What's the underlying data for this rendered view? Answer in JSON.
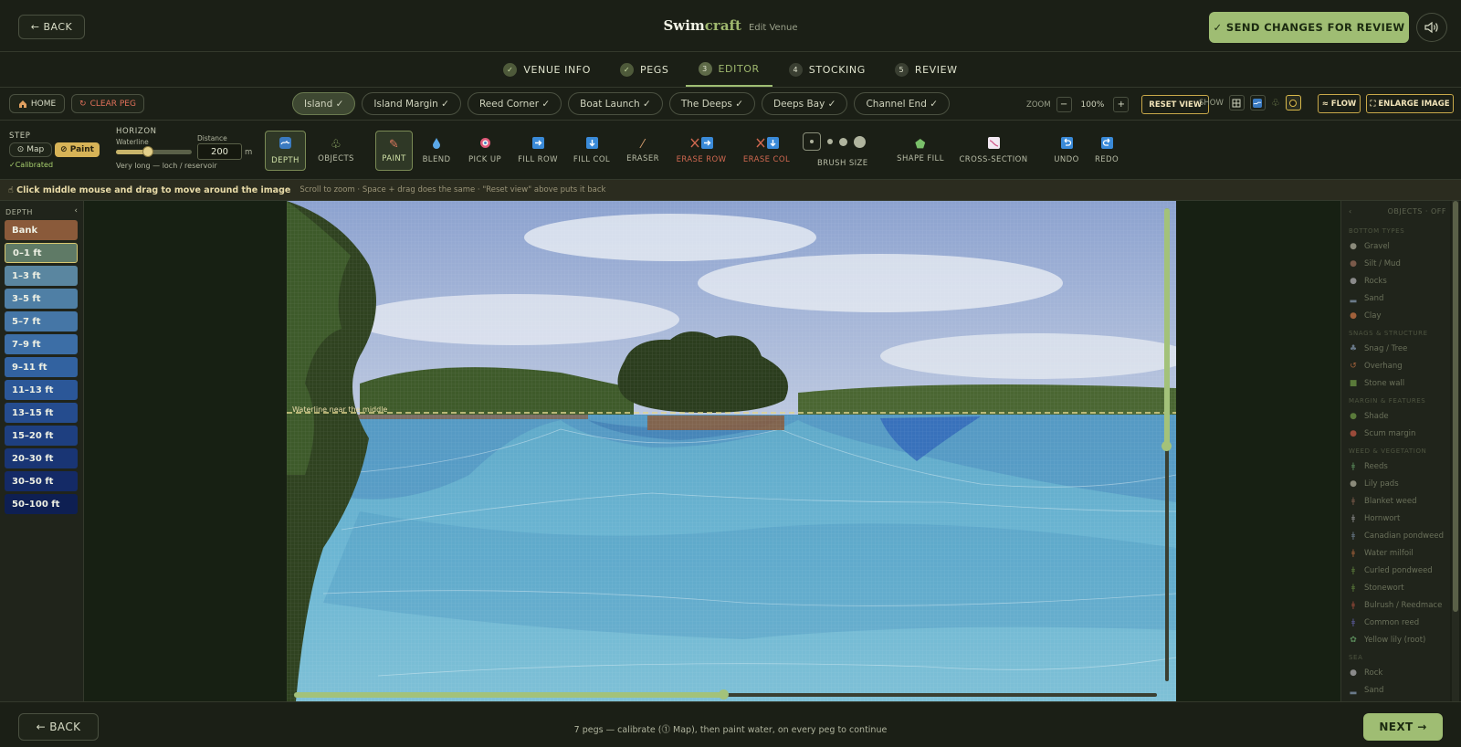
{
  "header": {
    "back_label": "← BACK",
    "brand_main": "Swim",
    "brand_accent": "craft",
    "subtitle": "Edit Venue",
    "send_label": "✓ SEND CHANGES FOR REVIEW",
    "speaker_icon": "speaker-icon"
  },
  "steps": [
    {
      "label": "VENUE INFO",
      "marker": "✓"
    },
    {
      "label": "PEGS",
      "marker": "✓"
    },
    {
      "label": "EDITOR",
      "marker": "3"
    },
    {
      "label": "STOCKING",
      "marker": "4"
    },
    {
      "label": "REVIEW",
      "marker": "5"
    }
  ],
  "pegbar": {
    "home_label": "HOME",
    "clear_label": "CLEAR PEG",
    "pegs": [
      "Island ✓",
      "Island Margin ✓",
      "Reed Corner ✓",
      "Boat Launch ✓",
      "The Deeps ✓",
      "Deeps Bay ✓",
      "Channel End ✓"
    ],
    "zoom_label": "ZOOM",
    "zoom_minus": "−",
    "zoom_value": "100%",
    "zoom_plus": "+",
    "reset_label": "RESET VIEW",
    "show_label": "SHOW",
    "flow_label": "≈ FLOW",
    "enlarge_label": "⛶ ENLARGE IMAGE"
  },
  "toolbar": {
    "step_label": "STEP",
    "map_label": "⊙ Map",
    "paint_label": "⊘ Paint",
    "calibrated": "✓Calibrated",
    "horizon_label": "HORIZON",
    "waterline_label": "Waterline",
    "waterline_level": 0.42,
    "horizon_hint": "Very long — loch / reservoir",
    "distance_label": "Distance",
    "distance_value": "200",
    "distance_unit": "m",
    "depth_label": "DEPTH",
    "objects_label": "OBJECTS",
    "paint_tool": "PAINT",
    "blend": "BLEND",
    "pick_up": "PICK UP",
    "fill_row": "FILL ROW",
    "fill_col": "FILL COL",
    "eraser": "ERASER",
    "erase_row": "ERASE ROW",
    "erase_col": "ERASE COL",
    "brush_size": "BRUSH SIZE",
    "shape_fill": "SHAPE FILL",
    "cross_section": "CROSS-SECTION",
    "undo": "UNDO",
    "redo": "REDO"
  },
  "hints": {
    "main": "☝ Click middle mouse and drag to move around the image",
    "sub": "Scroll to zoom · Space + drag does the same · \"Reset view\" above puts it back"
  },
  "depth": {
    "title": "DEPTH",
    "collapse": "‹",
    "items": [
      {
        "label": "Bank",
        "color": "#8a5a3a"
      },
      {
        "label": "0–1 ft",
        "color": "#5f7a66"
      },
      {
        "label": "1–3 ft",
        "color": "#5a86a0"
      },
      {
        "label": "3–5 ft",
        "color": "#4f7fa5"
      },
      {
        "label": "5–7 ft",
        "color": "#4576a6"
      },
      {
        "label": "7–9 ft",
        "color": "#3c6ea6"
      },
      {
        "label": "9–11 ft",
        "color": "#3262a0"
      },
      {
        "label": "11–13 ft",
        "color": "#2b5798"
      },
      {
        "label": "13–15 ft",
        "color": "#254c8e"
      },
      {
        "label": "15–20 ft",
        "color": "#1e3f80"
      },
      {
        "label": "20–30 ft",
        "color": "#193574"
      },
      {
        "label": "30–50 ft",
        "color": "#142a66"
      },
      {
        "label": "50–100 ft",
        "color": "#0e1f52"
      }
    ]
  },
  "canvas": {
    "waterline_label": "Waterline near the middle"
  },
  "objects": {
    "title": "OBJECTS · OFF",
    "collapse": "‹",
    "groups": [
      {
        "title": "BOTTOM TYPES",
        "items": [
          [
            "Gravel",
            "●"
          ],
          [
            "Silt / Mud",
            "●"
          ],
          [
            "Rocks",
            "●"
          ],
          [
            "Sand",
            "▂"
          ],
          [
            "Clay",
            "●"
          ]
        ]
      },
      {
        "title": "SNAGS & STRUCTURE",
        "items": [
          [
            "Snag / Tree",
            "♣"
          ],
          [
            "Overhang",
            "↺"
          ],
          [
            "Stone wall",
            "■"
          ]
        ]
      },
      {
        "title": "MARGIN & FEATURES",
        "items": [
          [
            "Shade",
            "●"
          ],
          [
            "Scum margin",
            "●"
          ]
        ]
      },
      {
        "title": "WEED & VEGETATION",
        "items": [
          [
            "Reeds",
            "ǂ"
          ],
          [
            "Lily pads",
            "●"
          ],
          [
            "Blanket weed",
            "ǂ"
          ],
          [
            "Hornwort",
            "ǂ"
          ],
          [
            "Canadian pondweed",
            "ǂ"
          ],
          [
            "Water milfoil",
            "ǂ"
          ],
          [
            "Curled pondweed",
            "ǂ"
          ],
          [
            "Stonewort",
            "ǂ"
          ],
          [
            "Bulrush / Reedmace",
            "ǂ"
          ],
          [
            "Common reed",
            "ǂ"
          ],
          [
            "Yellow lily (root)",
            "✿"
          ]
        ]
      },
      {
        "title": "SEA",
        "items": [
          [
            "Rock",
            "●"
          ],
          [
            "Sand",
            "▂"
          ]
        ]
      }
    ]
  },
  "footer": {
    "back_label": "← BACK",
    "message": "7 pegs — calibrate (⓵ Map), then paint water, on every peg to continue",
    "next_label": "NEXT →"
  }
}
